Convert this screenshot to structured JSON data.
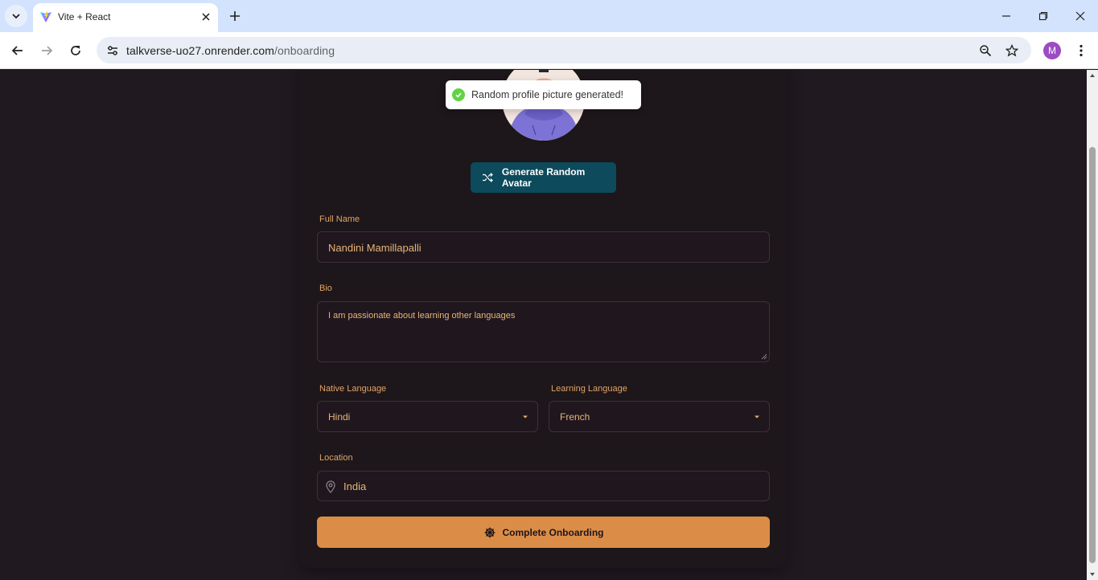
{
  "browser": {
    "tab_title": "Vite + React",
    "url_host": "talkverse-uo27.onrender.com",
    "url_path": "/onboarding",
    "profile_initial": "M"
  },
  "icons": {
    "tab_list": "chevron-down-icon",
    "favicon": "vite-logo-icon",
    "tab_close": "close-icon",
    "new_tab": "plus-icon",
    "back": "arrow-left-icon",
    "forward": "arrow-right-icon",
    "reload": "reload-icon",
    "site_info": "tune-icon",
    "zoom": "zoom-icon",
    "bookmark": "star-icon",
    "menu": "kebab-menu-icon",
    "shuffle": "shuffle-icon",
    "location": "map-pin-icon",
    "submit": "ship-wheel-icon",
    "toast_success": "check-circle-icon"
  },
  "toast": {
    "message": "Random profile picture generated!"
  },
  "onboarding": {
    "generate_button": "Generate Random Avatar",
    "full_name": {
      "label": "Full Name",
      "value": "Nandini Mamillapalli"
    },
    "bio": {
      "label": "Bio",
      "value": "I am passionate about learning other languages"
    },
    "native_language": {
      "label": "Native Language",
      "value": "Hindi"
    },
    "learning_language": {
      "label": "Learning Language",
      "value": "French"
    },
    "location": {
      "label": "Location",
      "value": "India"
    },
    "submit_button": "Complete Onboarding"
  },
  "colors": {
    "page_bg": "#211920",
    "accent": "#db8d48",
    "label_text": "#e2a464",
    "generate_button_bg": "#0c4a5c",
    "toast_success": "#61d345"
  }
}
